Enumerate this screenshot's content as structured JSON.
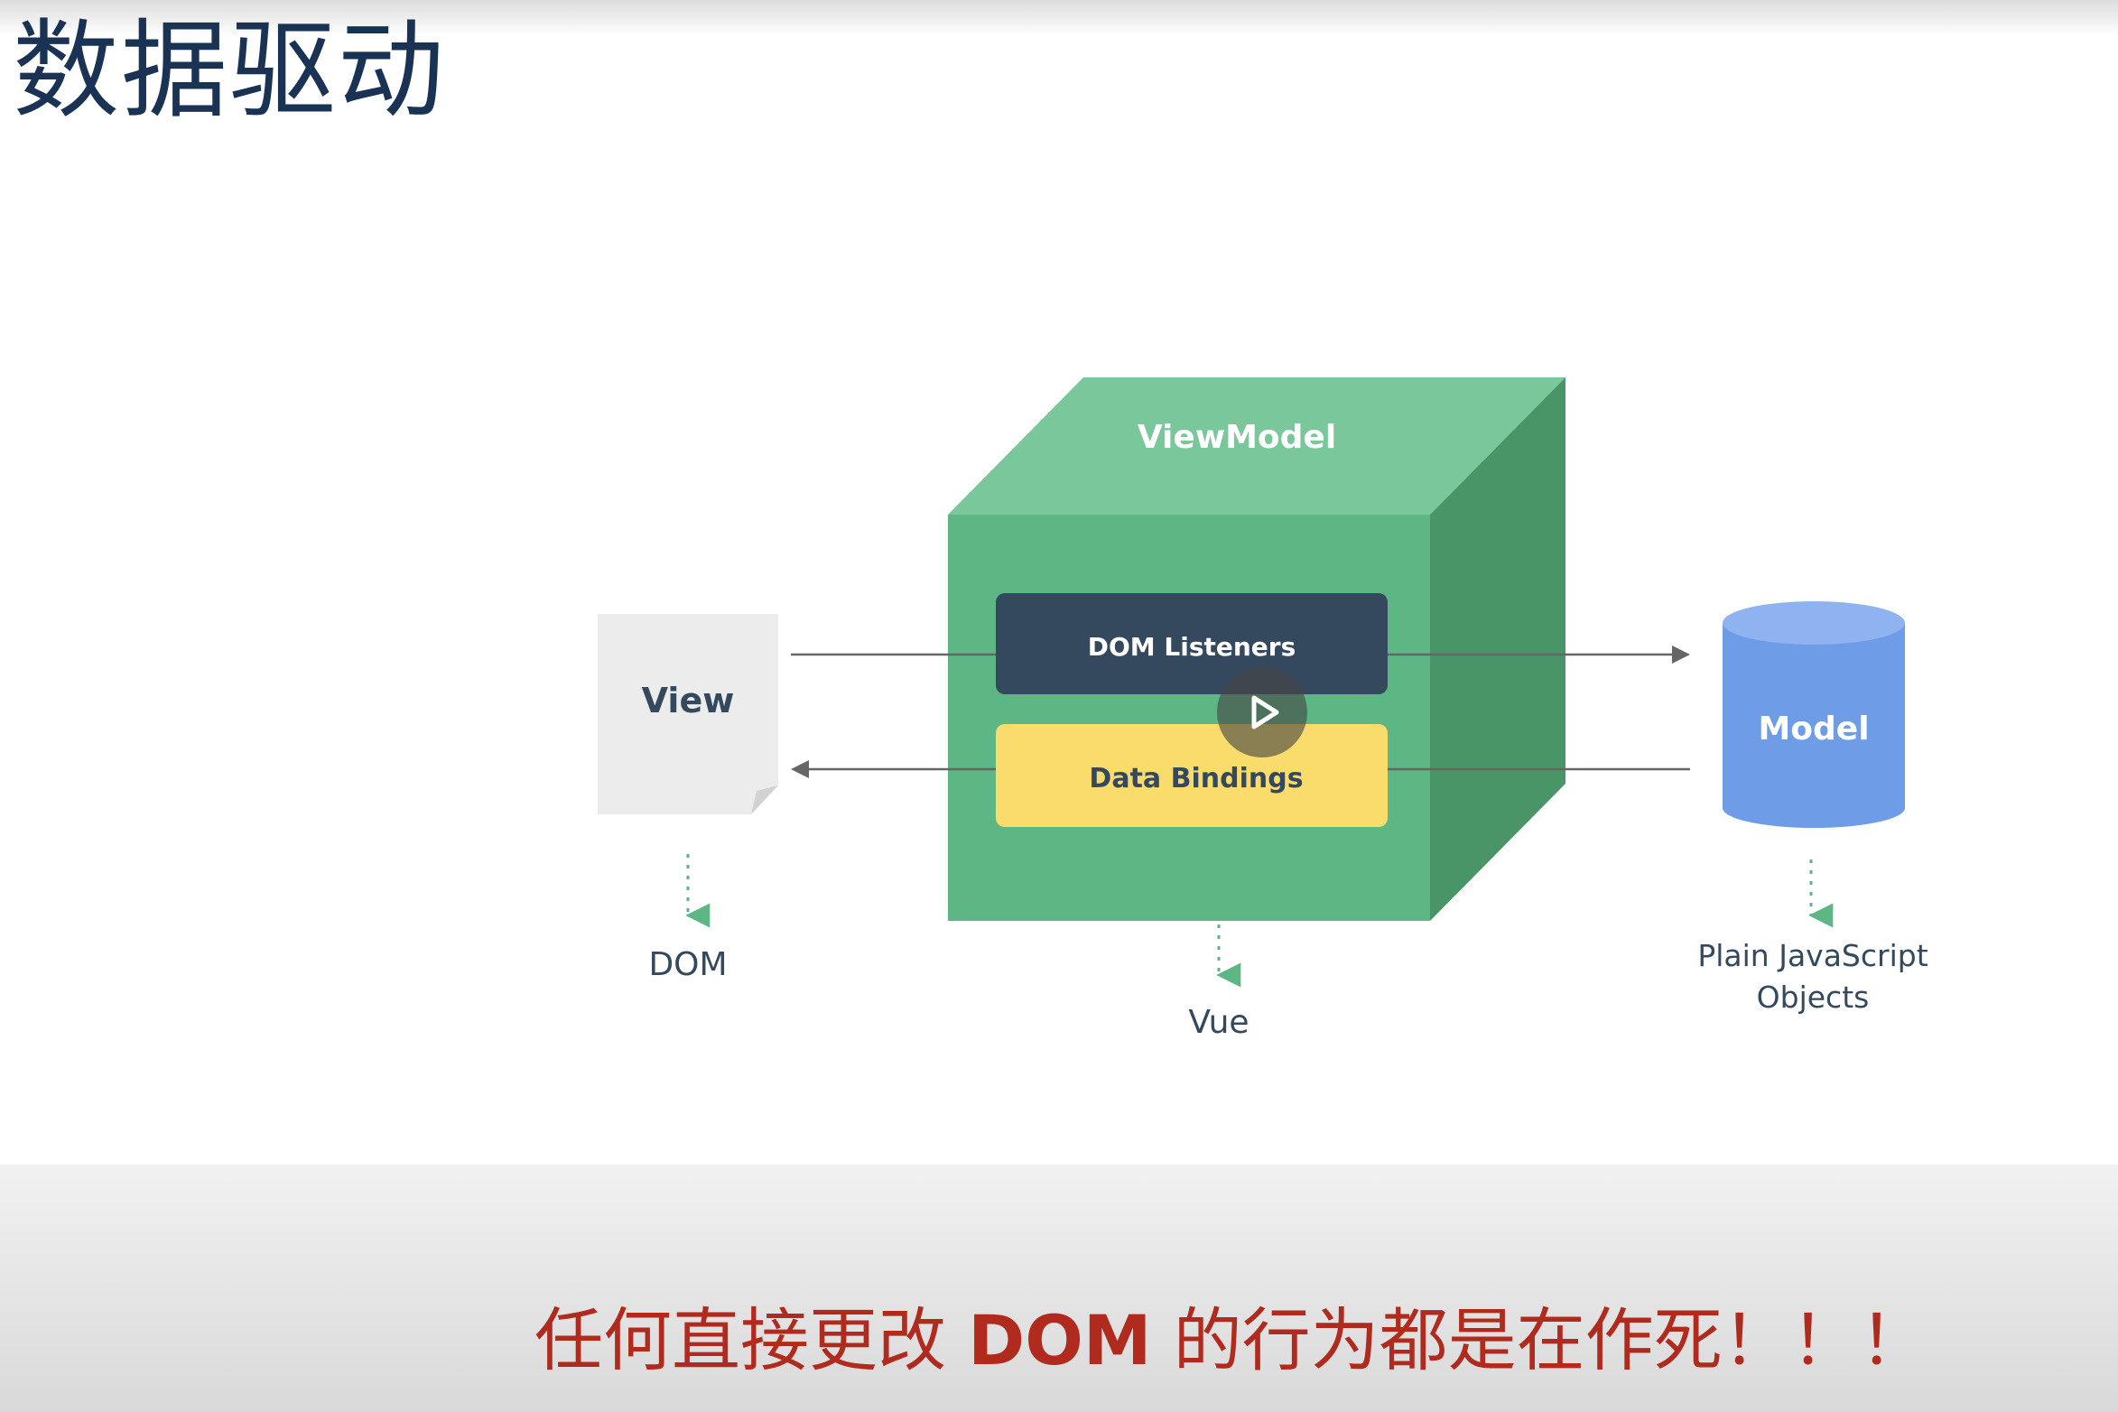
{
  "slide": {
    "title": "数据驱动",
    "caption_prefix": "任何直接更改 ",
    "caption_keyword": "DOM",
    "caption_suffix": " 的行为都是在作死！！！"
  },
  "diagram": {
    "viewmodel_label": "ViewModel",
    "dom_listeners_label": "DOM Listeners",
    "data_bindings_label": "Data Bindings",
    "view_label": "View",
    "model_label": "Model",
    "dom_caption": "DOM",
    "vue_caption": "Vue",
    "pjo_caption_line1": "Plain JavaScript",
    "pjo_caption_line2": "Objects"
  },
  "colors": {
    "cube_front": "#5cb785",
    "cube_top": "#79c79a",
    "cube_side": "#4a9568",
    "listeners_box": "#35495e",
    "bindings_box": "#f9dc6b",
    "model_cylinder": "#6f9ce6",
    "caption_red": "#b02a1e",
    "title_navy": "#1a3354"
  },
  "video": {
    "play_icon": "play-icon"
  }
}
